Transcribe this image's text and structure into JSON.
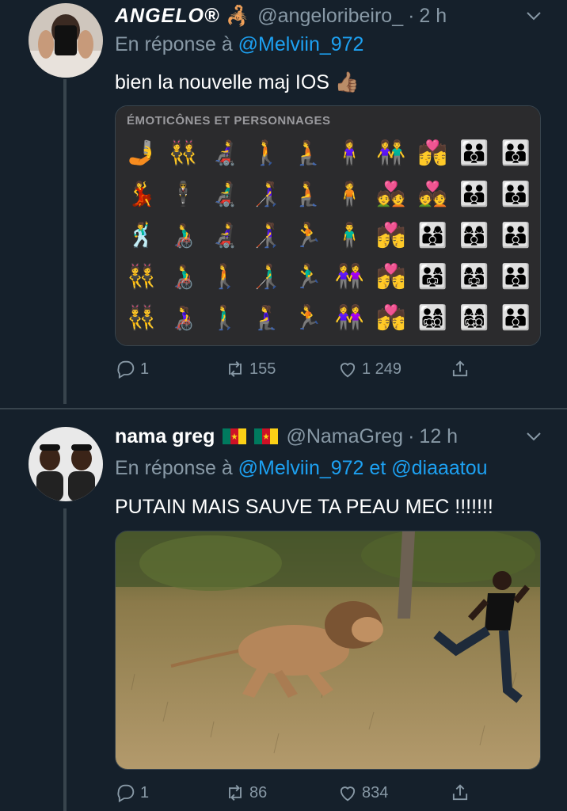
{
  "tweets": [
    {
      "display_name": "ANGELO®",
      "name_emoji": "🦂",
      "handle": "@angeloribeiro_",
      "time": "2 h",
      "reply_prefix": "En réponse à",
      "mentions": [
        "@Melviin_972"
      ],
      "text": "bien la nouvelle maj IOS 👍🏽",
      "media_caption": "ÉMOTICÔNES ET PERSONNAGES",
      "emoji_rows": [
        [
          "🤳",
          "👯",
          "👩‍🦼",
          "🚶",
          "🧎",
          "🧍‍♀️",
          "👫",
          "💏",
          "👪",
          "👪"
        ],
        [
          "💃",
          "🕴️",
          "👨‍🦼",
          "👩‍🦯",
          "🧎",
          "🧍",
          "💑",
          "💑",
          "👪",
          "👪"
        ],
        [
          "🕺",
          "👨‍🦽",
          "👩‍🦼",
          "👩‍🦯",
          "🏃",
          "🧍‍♂️",
          "💏",
          "👨‍👩‍👦",
          "👩‍👩‍👦",
          "👪"
        ],
        [
          "👯",
          "👨‍🦽",
          "🚶",
          "👨‍🦯",
          "🏃‍♂️",
          "👭",
          "💏",
          "👨‍👩‍👧",
          "👩‍👩‍👧",
          "👪"
        ],
        [
          "👯‍♂️",
          "👩‍🦽",
          "🚶‍♂️",
          "🧎‍♀️",
          "🏃",
          "👭",
          "💏",
          "👨‍👩‍👧‍👦",
          "👩‍👩‍👧‍👦",
          "👪"
        ]
      ],
      "replies": "1",
      "retweets": "155",
      "likes": "1 249"
    },
    {
      "display_name": "nama greg",
      "name_emoji": "🇨🇲 🇨🇲",
      "handle": "@NamaGreg",
      "time": "12 h",
      "reply_prefix": "En réponse à",
      "mentions": [
        "@Melviin_972",
        "@diaaatou"
      ],
      "mention_joiner": "et",
      "text": "PUTAIN MAIS SAUVE TA PEAU MEC !!!!!!!",
      "replies": "1",
      "retweets": "86",
      "likes": "834"
    }
  ],
  "colors": {
    "background": "#15202b",
    "muted": "#8899a6",
    "link": "#1da1f2",
    "border": "#38444d"
  },
  "icons": [
    "reply-icon",
    "retweet-icon",
    "like-icon",
    "share-icon",
    "chevron-down-icon"
  ]
}
